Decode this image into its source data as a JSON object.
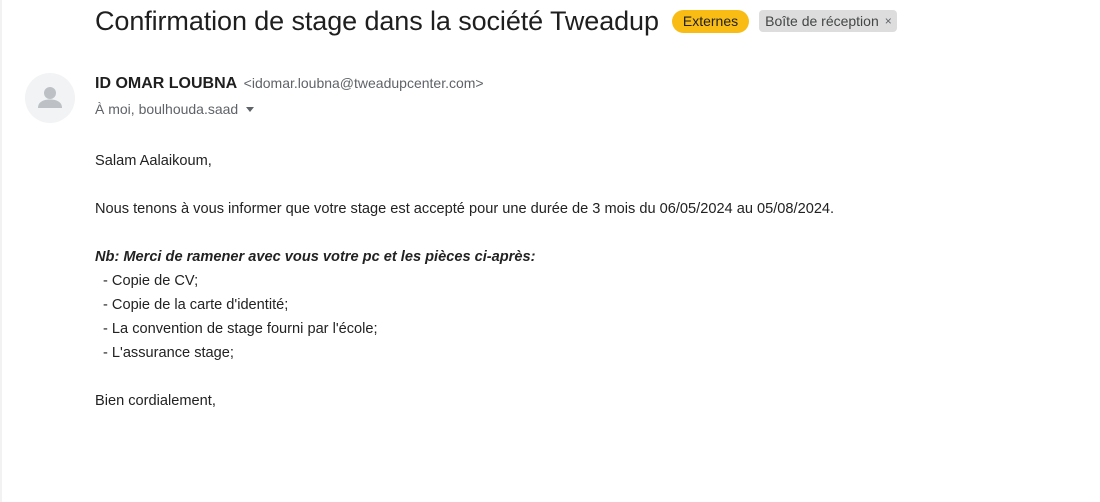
{
  "email": {
    "subject": "Confirmation de stage dans la société Tweadup",
    "labels": {
      "externes": "Externes",
      "inbox": "Boîte de réception",
      "inbox_close": "×"
    },
    "sender": {
      "name": "ID OMAR LOUBNA",
      "email": "<idomar.loubna@tweadupcenter.com>"
    },
    "recipients": "À moi, boulhouda.saad",
    "body": {
      "greeting": "Salam Aalaikoum,",
      "paragraph": "Nous tenons à vous informer que votre stage est accepté pour une durée de 3 mois du 06/05/2024 au 05/08/2024.",
      "nb": "Nb: Merci de ramener avec vous votre pc et les pièces ci-après:",
      "items": [
        "- Copie de CV;",
        "- Copie de la carte d'identité;",
        "- La convention de stage fourni par l'école;",
        "- L'assurance stage;"
      ],
      "closing": "Bien cordialement,"
    }
  },
  "colors": {
    "externes_label_bg": "#f9bc15",
    "inbox_label_bg": "#dddddd",
    "avatar_bg": "#f1f3f4",
    "avatar_fg": "#bdc1c6"
  },
  "icons": {
    "avatar": "person-icon",
    "recipients_toggle": "caret-down-icon",
    "remove_label": "close-icon"
  }
}
